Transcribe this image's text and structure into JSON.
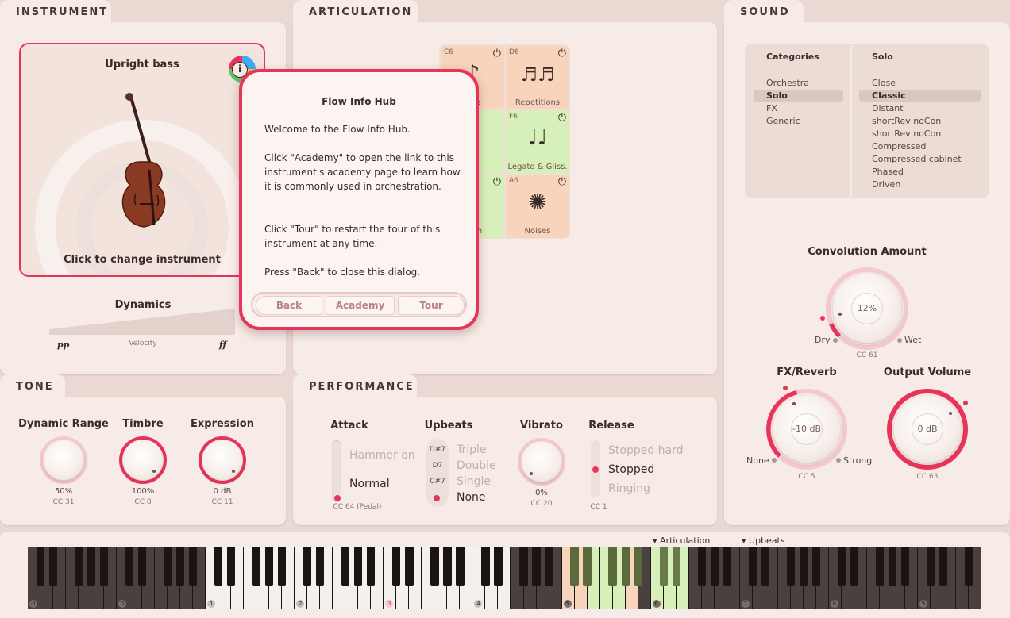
{
  "instrument": {
    "tab": "INSTRUMENT",
    "name": "Upright bass",
    "change_label": "Click to change instrument",
    "dynamics_label": "Dynamics",
    "pp": "pp",
    "ff": "ff",
    "velocity": "Velocity"
  },
  "articulation": {
    "tab": "ARTICULATION",
    "cells": [
      {
        "note": "C6",
        "name": "otes",
        "color": "orange"
      },
      {
        "note": "D6",
        "name": "Repetitions",
        "color": "orange"
      },
      {
        "note": "",
        "name": "s",
        "color": "green"
      },
      {
        "note": "F6",
        "name": "Legato & Gliss.",
        "color": "green"
      },
      {
        "note": "",
        "name": "stain",
        "color": "green"
      },
      {
        "note": "A6",
        "name": "Noises",
        "color": "orange"
      }
    ]
  },
  "sound": {
    "tab": "SOUND",
    "categories_header": "Categories",
    "solo_header": "Solo",
    "categories": [
      "Orchestra",
      "Solo",
      "FX",
      "Generic"
    ],
    "categories_selected": "Solo",
    "presets": [
      "Close",
      "Classic",
      "Distant",
      "shortRev noCon",
      "shortRev noCon",
      "Compressed",
      "Compressed cabinet",
      "Phased",
      "Driven"
    ],
    "presets_selected": "Classic",
    "convolution_label": "Convolution Amount",
    "convolution_value": "12%",
    "dry": "Dry",
    "wet": "Wet",
    "convolution_cc": "CC 61",
    "fx_label": "FX/Reverb",
    "fx_value": "-10 dB",
    "fx_none": "None",
    "fx_strong": "Strong",
    "fx_cc": "CC 5",
    "output_label": "Output Volume",
    "output_value": "0 dB",
    "output_cc": "CC 63"
  },
  "tone": {
    "tab": "TONE",
    "knobs": [
      {
        "label": "Dynamic Range",
        "value": "50%",
        "cc": "CC 31"
      },
      {
        "label": "Timbre",
        "value": "100%",
        "cc": "CC 8"
      },
      {
        "label": "Expression",
        "value": "0 dB",
        "cc": "CC 11"
      }
    ]
  },
  "performance": {
    "tab": "PERFORMANCE",
    "attack": {
      "label": "Attack",
      "options": [
        "Hammer on",
        "Normal"
      ],
      "cc": "CC 64 (Pedal)"
    },
    "upbeats": {
      "label": "Upbeats",
      "notes": [
        "D#7",
        "D7",
        "C#7"
      ],
      "options": [
        "Triple",
        "Double",
        "Single",
        "None"
      ]
    },
    "vibrato": {
      "label": "Vibrato",
      "value": "0%",
      "cc": "CC 20"
    },
    "release": {
      "label": "Release",
      "options": [
        "Stopped hard",
        "Stopped",
        "Ringing"
      ],
      "cc": "CC 1"
    }
  },
  "dialog": {
    "title": "Flow Info Hub",
    "p1": "Welcome to the Flow Info Hub.",
    "p2": "Click \"Academy\" to open the link to this instrument's academy page to learn how it is commonly used in orchestration.",
    "p3": "Click \"Tour\" to restart the tour of this instrument at any time.",
    "p4": "Press \"Back\" to close this dialog.",
    "back": "Back",
    "academy": "Academy",
    "tour": "Tour"
  },
  "keyboard": {
    "articulation_marker": "Articulation",
    "upbeats_marker": "Upbeats",
    "octaves": [
      "-1",
      "0",
      "1",
      "2",
      "3",
      "4",
      "5",
      "6",
      "7",
      "8",
      "9"
    ]
  },
  "colors": {
    "accent": "#e8335a",
    "panel": "#f6ebe6",
    "orange": "#f8d4bc",
    "green": "#d7efb8"
  }
}
